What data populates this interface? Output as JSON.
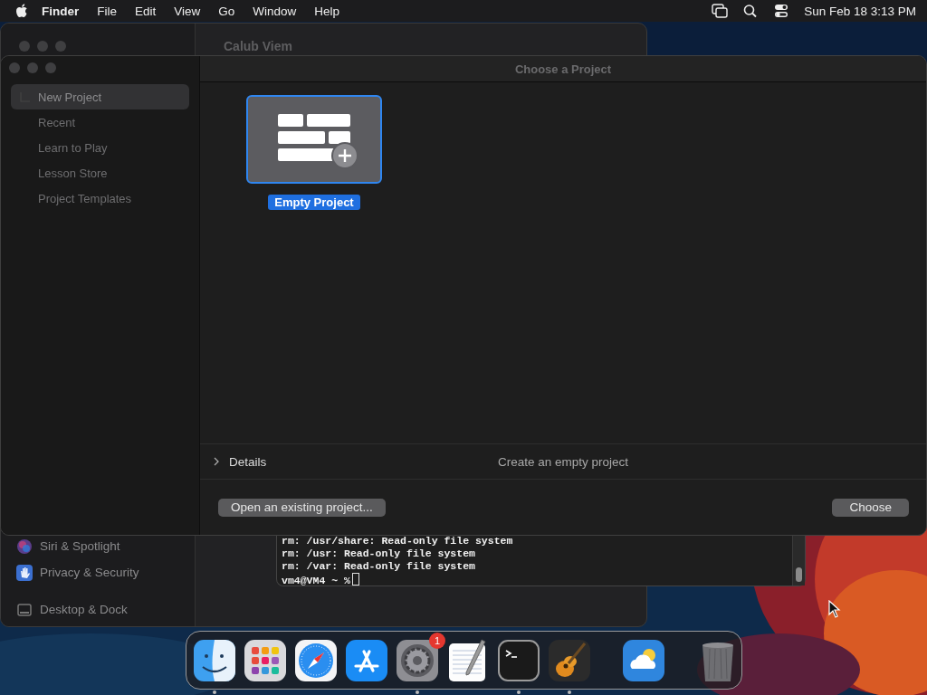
{
  "menu_bar": {
    "app": "Finder",
    "menus": [
      "File",
      "Edit",
      "View",
      "Go",
      "Window",
      "Help"
    ],
    "clock": "Sun Feb 18  3:13 PM"
  },
  "background_window": {
    "title": "Calub Viem",
    "sidebar_items": [
      {
        "label": "Siri & Spotlight",
        "kind": "siri"
      },
      {
        "label": "Privacy & Security",
        "kind": "privacy"
      },
      {
        "label": "Desktop & Dock",
        "kind": "desktop"
      }
    ]
  },
  "terminal": {
    "lines": [
      "rm: /usr/share: Read-only file system",
      "rm: /usr: Read-only file system",
      "rm: /var: Read-only file system"
    ],
    "prompt": "vm4@VM4 ~ %"
  },
  "dialog": {
    "title": "Choose a Project",
    "sidebar": [
      {
        "label": "New Project",
        "selected": true
      },
      {
        "label": "Recent",
        "selected": false
      },
      {
        "label": "Learn to Play",
        "selected": false
      },
      {
        "label": "Lesson Store",
        "selected": false
      },
      {
        "label": "Project Templates",
        "selected": false
      }
    ],
    "templates": [
      {
        "label": "Empty Project",
        "selected": true
      }
    ],
    "details": {
      "label": "Details",
      "expanded": false,
      "description": "Create an empty project"
    },
    "buttons": [
      {
        "label": "Open an existing project...",
        "kind": "secondary"
      },
      {
        "label": "Choose",
        "kind": "primary"
      }
    ]
  },
  "dock": {
    "apps": [
      {
        "kind": "finder",
        "running": true
      },
      {
        "kind": "launchpad",
        "running": false
      },
      {
        "kind": "safari",
        "running": false
      },
      {
        "kind": "appstore",
        "running": false
      },
      {
        "kind": "settings",
        "running": true,
        "badge": "1"
      },
      {
        "kind": "textedit",
        "running": false
      },
      {
        "kind": "terminal",
        "running": true
      },
      {
        "kind": "guitar",
        "running": true
      },
      {
        "kind": "weather",
        "running": false
      },
      {
        "kind": "trash",
        "running": false
      }
    ]
  }
}
